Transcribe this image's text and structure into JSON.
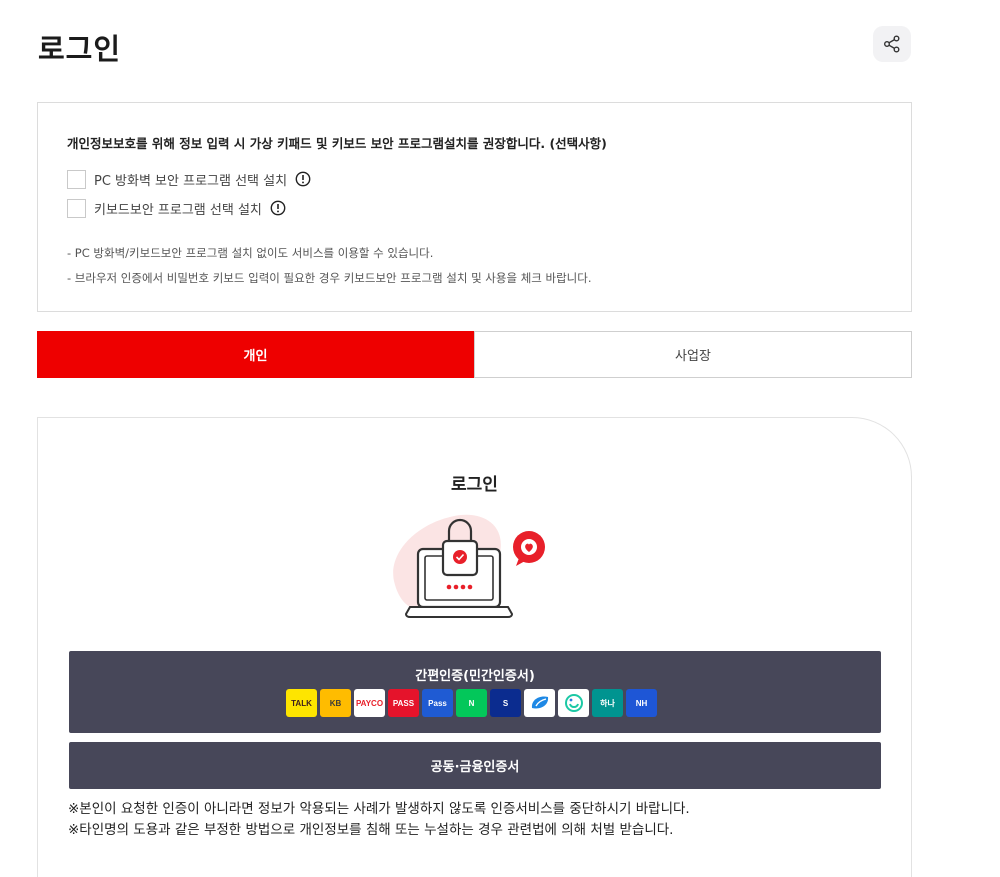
{
  "page": {
    "title": "로그인"
  },
  "share": {
    "icon": "share-icon"
  },
  "notice": {
    "title": "개인정보보호를 위해 정보 입력 시 가상 키패드 및 키보드 보안 프로그램설치를 권장합니다. (선택사항)",
    "options": [
      {
        "label": "PC 방화벽 보안 프로그램 선택 설치",
        "checked": false
      },
      {
        "label": "키보드보안 프로그램 선택 설치",
        "checked": false
      }
    ],
    "lines": [
      "- PC 방화벽/키보드보안 프로그램 설치 없이도 서비스를 이용할 수 있습니다.",
      "- 브라우저 인증에서 비밀번호 키보드 입력이 필요한 경우 키보드보안 프로그램 설치 및 사용을 체크 바랍니다."
    ]
  },
  "tabs": {
    "personal": "개인",
    "business": "사업장",
    "active": "personal"
  },
  "card": {
    "title": "로그인",
    "simple_auth_label": "간편인증(민간인증서)",
    "providers": [
      {
        "text": "TALK",
        "color": "#fee500"
      },
      {
        "text": "KB",
        "color": "#ffbc00"
      },
      {
        "text": "PAYCO",
        "color": "#ffffff"
      },
      {
        "text": "PASS",
        "color": "#e5132b"
      },
      {
        "text": "Pass",
        "color": "#1f5bd3"
      },
      {
        "text": "N",
        "color": "#03c75a"
      },
      {
        "text": "S",
        "color": "#0b2c8f"
      },
      {
        "text": "",
        "color": "#ffffff"
      },
      {
        "text": "",
        "color": "#ffffff"
      },
      {
        "text": "하나",
        "color": "#009490"
      },
      {
        "text": "NH",
        "color": "#1e56d6"
      }
    ],
    "cert_label": "공동·금융인증서",
    "warnings": [
      "※본인이 요청한 인증이 아니라면 정보가 악용되는 사례가 발생하지 않도록 인증서비스를 중단하시기 바랍니다.",
      "※타인명의 도용과 같은 부정한 방법으로 개인정보를 침해 또는 누설하는 경우 관련법에 의해 처벌 받습니다."
    ]
  },
  "colors": {
    "accent": "#ee0000",
    "dark_button": "#474759"
  }
}
